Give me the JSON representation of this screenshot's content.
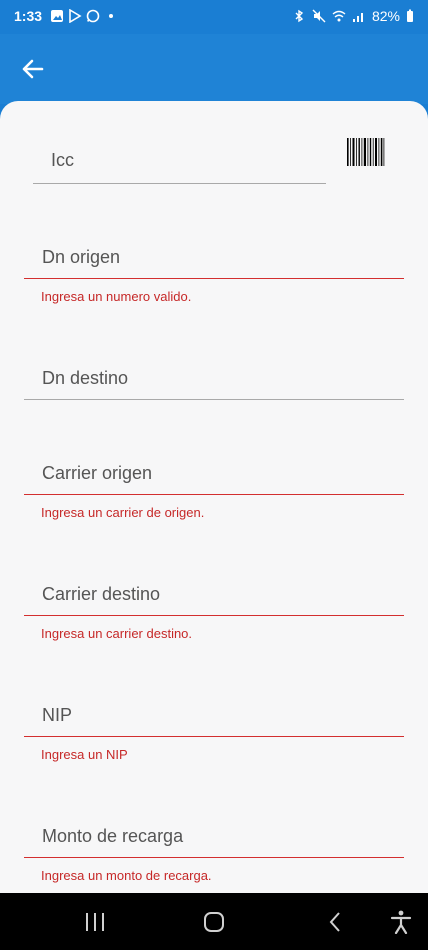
{
  "status_bar": {
    "time": "1:33",
    "battery": "82%"
  },
  "form": {
    "icc": {
      "label": "Icc"
    },
    "dn_origen": {
      "label": "Dn origen",
      "error": "Ingresa un numero valido."
    },
    "dn_destino": {
      "label": "Dn destino"
    },
    "carrier_origen": {
      "label": "Carrier origen",
      "error": "Ingresa un carrier de origen."
    },
    "carrier_destino": {
      "label": "Carrier destino",
      "error": "Ingresa un carrier destino."
    },
    "nip": {
      "label": "NIP",
      "error": "Ingresa un NIP"
    },
    "monto": {
      "label": "Monto de recarga",
      "error": "Ingresa un monto de recarga."
    }
  },
  "colors": {
    "app_bar": "#1f83d6",
    "error": "#c62828",
    "sheet_background": "#f7f7f8"
  }
}
